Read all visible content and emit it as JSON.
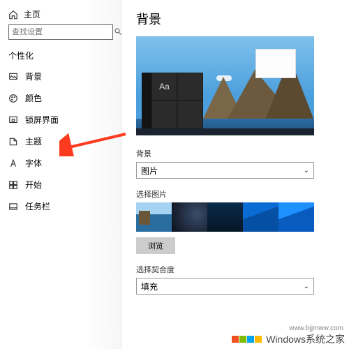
{
  "sidebar": {
    "home": "主页",
    "search_placeholder": "查找设置",
    "group": "个性化",
    "items": [
      {
        "label": "背景"
      },
      {
        "label": "颜色"
      },
      {
        "label": "锁屏界面"
      },
      {
        "label": "主题"
      },
      {
        "label": "字体"
      },
      {
        "label": "开始"
      },
      {
        "label": "任务栏"
      }
    ]
  },
  "main": {
    "title": "背景",
    "preview_tile_text": "Aa",
    "bg_section": {
      "label": "背景",
      "value": "图片"
    },
    "choose_section": {
      "label": "选择图片",
      "browse": "浏览"
    },
    "fit_section": {
      "label": "选择契合度",
      "value": "填充"
    }
  },
  "watermark": {
    "text": "Windows系统之家",
    "url": "www.bjjmww.com"
  }
}
